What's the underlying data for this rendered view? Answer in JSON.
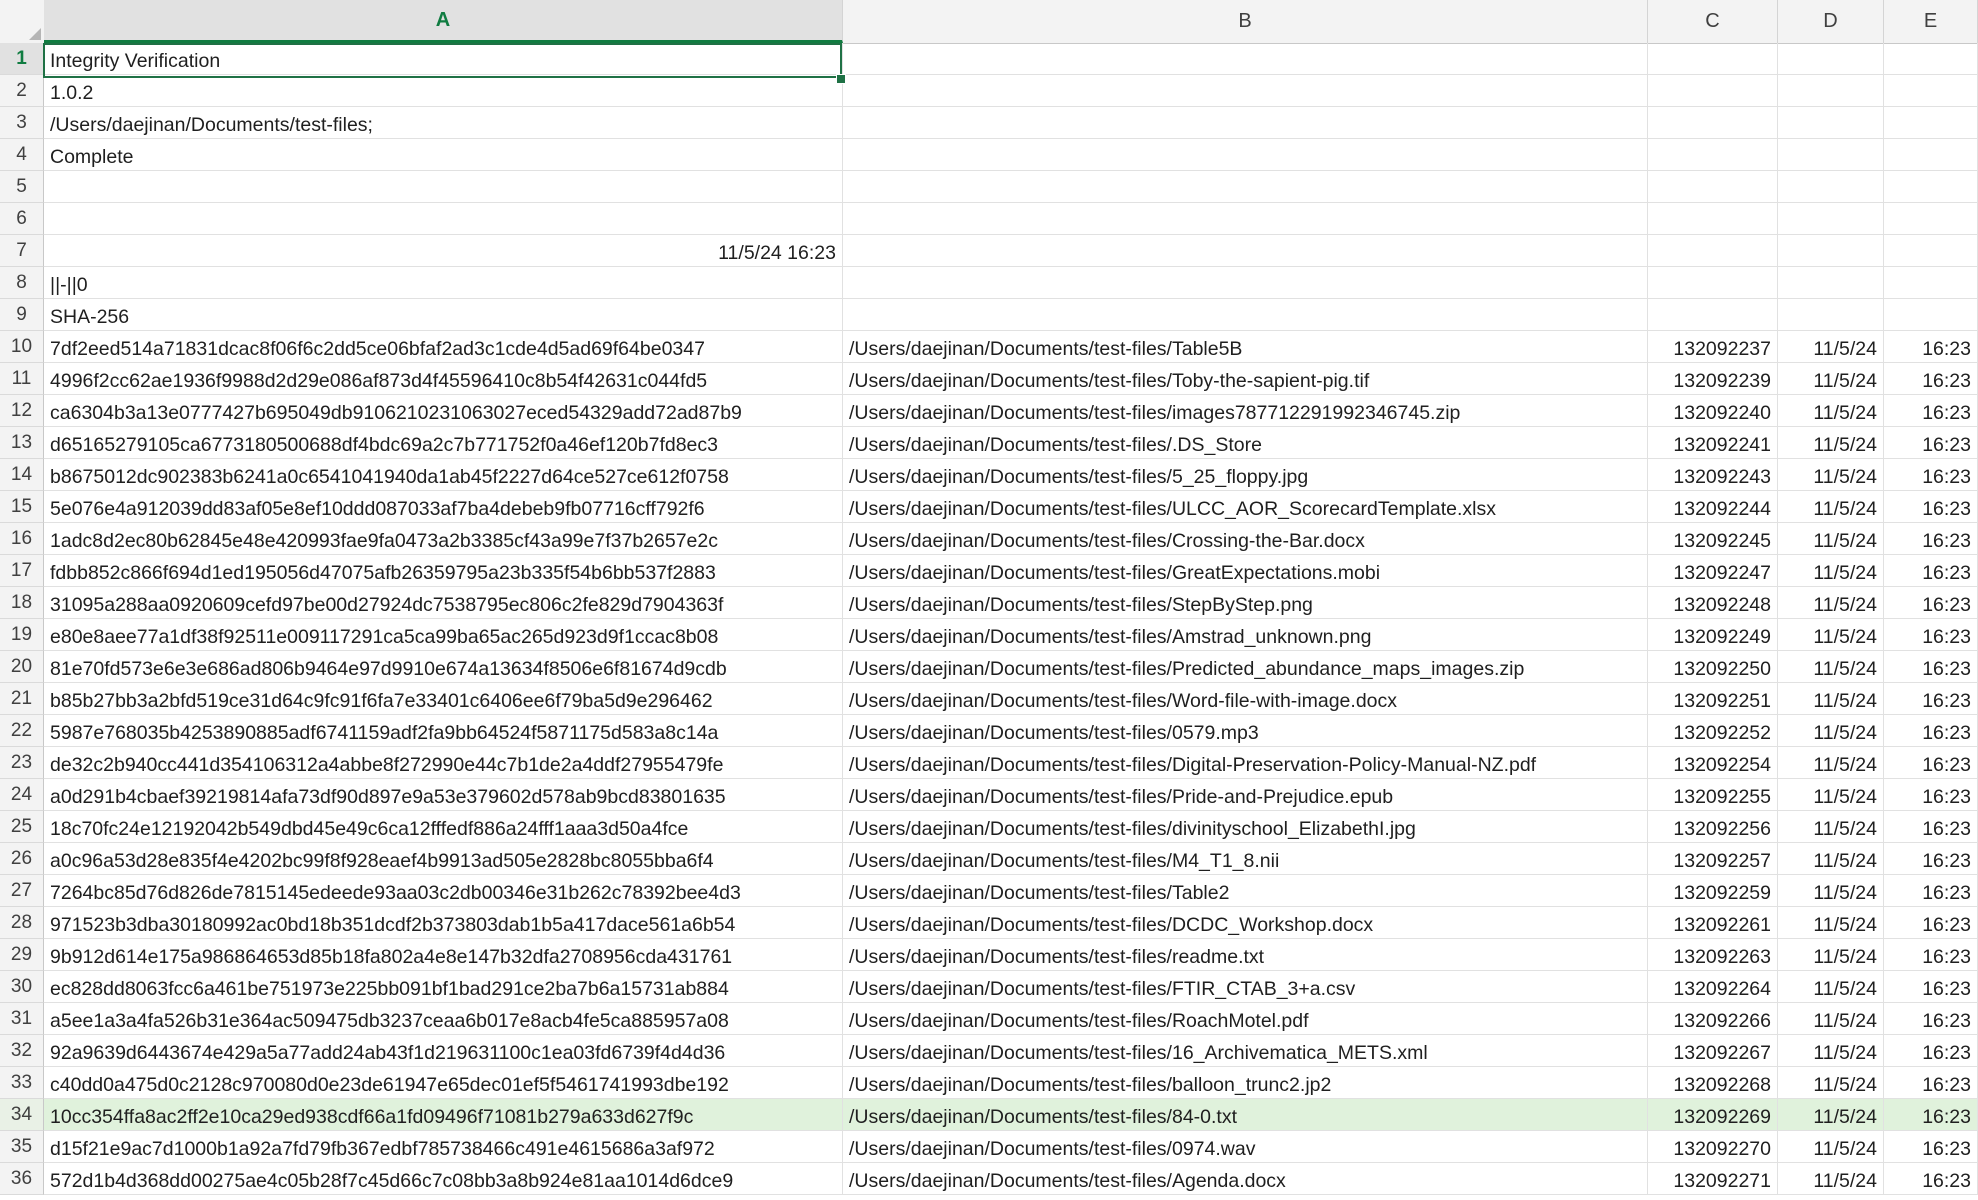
{
  "columns": [
    "A",
    "B",
    "C",
    "D",
    "E"
  ],
  "active_cell": "A1",
  "header_rows": [
    {
      "row": "1",
      "a": "Integrity Verification"
    },
    {
      "row": "2",
      "a": "1.0.2"
    },
    {
      "row": "3",
      "a": "/Users/daejinan/Documents/test-files;"
    },
    {
      "row": "4",
      "a": "Complete"
    },
    {
      "row": "5",
      "a": ""
    },
    {
      "row": "6",
      "a": ""
    },
    {
      "row": "7",
      "a": "11/5/24 16:23"
    },
    {
      "row": "8",
      "a": "||-||0"
    },
    {
      "row": "9",
      "a": "SHA-256"
    }
  ],
  "file_rows": [
    {
      "row": "10",
      "hash": "7df2eed514a71831dcac8f06f6c2dd5ce06bfaf2ad3c1cde4d5ad69f64be0347",
      "path": "/Users/daejinan/Documents/test-files/Table5B",
      "id": "132092237",
      "date": "11/5/24",
      "time": "16:23"
    },
    {
      "row": "11",
      "hash": "4996f2cc62ae1936f9988d2d29e086af873d4f45596410c8b54f42631c044fd5",
      "path": "/Users/daejinan/Documents/test-files/Toby-the-sapient-pig.tif",
      "id": "132092239",
      "date": "11/5/24",
      "time": "16:23"
    },
    {
      "row": "12",
      "hash": "ca6304b3a13e0777427b695049db9106210231063027eced54329add72ad87b9",
      "path": "/Users/daejinan/Documents/test-files/images787712291992346745.zip",
      "id": "132092240",
      "date": "11/5/24",
      "time": "16:23"
    },
    {
      "row": "13",
      "hash": "d65165279105ca6773180500688df4bdc69a2c7b771752f0a46ef120b7fd8ec3",
      "path": "/Users/daejinan/Documents/test-files/.DS_Store",
      "id": "132092241",
      "date": "11/5/24",
      "time": "16:23"
    },
    {
      "row": "14",
      "hash": "b8675012dc902383b6241a0c6541041940da1ab45f2227d64ce527ce612f0758",
      "path": "/Users/daejinan/Documents/test-files/5_25_floppy.jpg",
      "id": "132092243",
      "date": "11/5/24",
      "time": "16:23"
    },
    {
      "row": "15",
      "hash": "5e076e4a912039dd83af05e8ef10ddd087033af7ba4debeb9fb07716cff792f6",
      "path": "/Users/daejinan/Documents/test-files/ULCC_AOR_ScorecardTemplate.xlsx",
      "id": "132092244",
      "date": "11/5/24",
      "time": "16:23"
    },
    {
      "row": "16",
      "hash": "1adc8d2ec80b62845e48e420993fae9fa0473a2b3385cf43a99e7f37b2657e2c",
      "path": "/Users/daejinan/Documents/test-files/Crossing-the-Bar.docx",
      "id": "132092245",
      "date": "11/5/24",
      "time": "16:23"
    },
    {
      "row": "17",
      "hash": "fdbb852c866f694d1ed195056d47075afb26359795a23b335f54b6bb537f2883",
      "path": "/Users/daejinan/Documents/test-files/GreatExpectations.mobi",
      "id": "132092247",
      "date": "11/5/24",
      "time": "16:23"
    },
    {
      "row": "18",
      "hash": "31095a288aa0920609cefd97be00d27924dc7538795ec806c2fe829d7904363f",
      "path": "/Users/daejinan/Documents/test-files/StepByStep.png",
      "id": "132092248",
      "date": "11/5/24",
      "time": "16:23"
    },
    {
      "row": "19",
      "hash": "e80e8aee77a1df38f92511e009117291ca5ca99ba65ac265d923d9f1ccac8b08",
      "path": "/Users/daejinan/Documents/test-files/Amstrad_unknown.png",
      "id": "132092249",
      "date": "11/5/24",
      "time": "16:23"
    },
    {
      "row": "20",
      "hash": "81e70fd573e6e3e686ad806b9464e97d9910e674a13634f8506e6f81674d9cdb",
      "path": "/Users/daejinan/Documents/test-files/Predicted_abundance_maps_images.zip",
      "id": "132092250",
      "date": "11/5/24",
      "time": "16:23"
    },
    {
      "row": "21",
      "hash": "b85b27bb3a2bfd519ce31d64c9fc91f6fa7e33401c6406ee6f79ba5d9e296462",
      "path": "/Users/daejinan/Documents/test-files/Word-file-with-image.docx",
      "id": "132092251",
      "date": "11/5/24",
      "time": "16:23"
    },
    {
      "row": "22",
      "hash": "5987e768035b4253890885adf6741159adf2fa9bb64524f5871175d583a8c14a",
      "path": "/Users/daejinan/Documents/test-files/0579.mp3",
      "id": "132092252",
      "date": "11/5/24",
      "time": "16:23"
    },
    {
      "row": "23",
      "hash": "de32c2b940cc441d354106312a4abbe8f272990e44c7b1de2a4ddf27955479fe",
      "path": "/Users/daejinan/Documents/test-files/Digital-Preservation-Policy-Manual-NZ.pdf",
      "id": "132092254",
      "date": "11/5/24",
      "time": "16:23"
    },
    {
      "row": "24",
      "hash": "a0d291b4cbaef39219814afa73df90d897e9a53e379602d578ab9bcd83801635",
      "path": "/Users/daejinan/Documents/test-files/Pride-and-Prejudice.epub",
      "id": "132092255",
      "date": "11/5/24",
      "time": "16:23"
    },
    {
      "row": "25",
      "hash": "18c70fc24e12192042b549dbd45e49c6ca12fffedf886a24fff1aaa3d50a4fce",
      "path": "/Users/daejinan/Documents/test-files/divinityschool_ElizabethI.jpg",
      "id": "132092256",
      "date": "11/5/24",
      "time": "16:23"
    },
    {
      "row": "26",
      "hash": "a0c96a53d28e835f4e4202bc99f8f928eaef4b9913ad505e2828bc8055bba6f4",
      "path": "/Users/daejinan/Documents/test-files/M4_T1_8.nii",
      "id": "132092257",
      "date": "11/5/24",
      "time": "16:23"
    },
    {
      "row": "27",
      "hash": "7264bc85d76d826de7815145edeede93aa03c2db00346e31b262c78392bee4d3",
      "path": "/Users/daejinan/Documents/test-files/Table2",
      "id": "132092259",
      "date": "11/5/24",
      "time": "16:23"
    },
    {
      "row": "28",
      "hash": "971523b3dba30180992ac0bd18b351dcdf2b373803dab1b5a417dace561a6b54",
      "path": "/Users/daejinan/Documents/test-files/DCDC_Workshop.docx",
      "id": "132092261",
      "date": "11/5/24",
      "time": "16:23"
    },
    {
      "row": "29",
      "hash": "9b912d614e175a986864653d85b18fa802a4e8e147b32dfa2708956cda431761",
      "path": "/Users/daejinan/Documents/test-files/readme.txt",
      "id": "132092263",
      "date": "11/5/24",
      "time": "16:23"
    },
    {
      "row": "30",
      "hash": "ec828dd8063fcc6a461be751973e225bb091bf1bad291ce2ba7b6a15731ab884",
      "path": "/Users/daejinan/Documents/test-files/FTIR_CTAB_3+a.csv",
      "id": "132092264",
      "date": "11/5/24",
      "time": "16:23"
    },
    {
      "row": "31",
      "hash": "a5ee1a3a4fa526b31e364ac509475db3237ceaa6b017e8acb4fe5ca885957a08",
      "path": "/Users/daejinan/Documents/test-files/RoachMotel.pdf",
      "id": "132092266",
      "date": "11/5/24",
      "time": "16:23"
    },
    {
      "row": "32",
      "hash": "92a9639d6443674e429a5a77add24ab43f1d219631100c1ea03fd6739f4d4d36",
      "path": "/Users/daejinan/Documents/test-files/16_Archivematica_METS.xml",
      "id": "132092267",
      "date": "11/5/24",
      "time": "16:23"
    },
    {
      "row": "33",
      "hash": "c40dd0a475d0c2128c970080d0e23de61947e65dec01ef5f5461741993dbe192",
      "path": "/Users/daejinan/Documents/test-files/balloon_trunc2.jp2",
      "id": "132092268",
      "date": "11/5/24",
      "time": "16:23"
    },
    {
      "row": "34",
      "hash": "10cc354ffa8ac2ff2e10ca29ed938cdf66a1fd09496f71081b279a633d627f9c",
      "path": "/Users/daejinan/Documents/test-files/84-0.txt",
      "id": "132092269",
      "date": "11/5/24",
      "time": "16:23",
      "highlight": true
    },
    {
      "row": "35",
      "hash": "d15f21e9ac7d1000b1a92a7fd79fb367edbf785738466c491e4615686a3af972",
      "path": "/Users/daejinan/Documents/test-files/0974.wav",
      "id": "132092270",
      "date": "11/5/24",
      "time": "16:23"
    },
    {
      "row": "36",
      "hash": "572d1b4d368dd00275ae4c05b28f7c45d66c7c08bb3a8b924e81aa1014d6dce9",
      "path": "/Users/daejinan/Documents/test-files/Agenda.docx",
      "id": "132092271",
      "date": "11/5/24",
      "time": "16:23"
    }
  ],
  "colors": {
    "accent": "#107c41",
    "highlight_row": "#e0f2dc"
  }
}
